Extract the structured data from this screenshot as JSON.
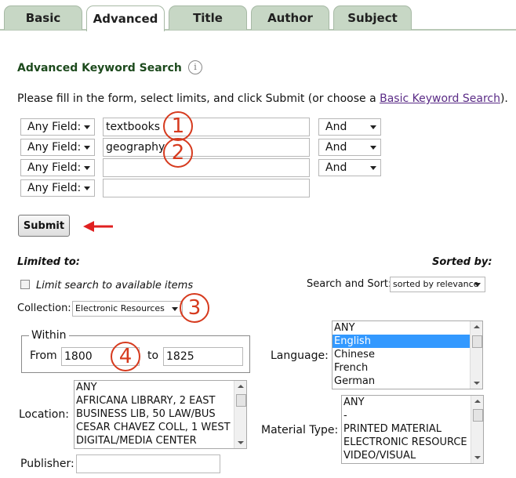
{
  "tabs": [
    {
      "label": "Basic",
      "active": false
    },
    {
      "label": "Advanced",
      "active": true
    },
    {
      "label": "Title",
      "active": false
    },
    {
      "label": "Author",
      "active": false
    },
    {
      "label": "Subject",
      "active": false
    }
  ],
  "heading": "Advanced Keyword Search",
  "info_icon": "info-icon",
  "instructions": {
    "before": "Please fill in the form, select limits, and click Submit (or choose a ",
    "link": "Basic Keyword Search",
    "after": ")."
  },
  "rows": [
    {
      "field": "Any Field:",
      "value": "textbooks",
      "operator": "And"
    },
    {
      "field": "Any Field:",
      "value": "geography",
      "operator": "And"
    },
    {
      "field": "Any Field:",
      "value": "",
      "operator": "And"
    },
    {
      "field": "Any Field:",
      "value": ""
    }
  ],
  "annotations": [
    "1",
    "2",
    "3",
    "4"
  ],
  "annotation_color": "#d63a1e",
  "submit_label": "Submit",
  "limits": {
    "limited_to": "Limited to:",
    "sorted_by": "Sorted by:",
    "available_label": "Limit search to available items",
    "search_sort_label": "Search and Sort:",
    "search_sort_value": "sorted by relevance",
    "collection_label": "Collection:",
    "collection_value": "Electronic Resources",
    "within_legend": "Within",
    "from_label": "From",
    "from_value": "1800",
    "to_label": "to",
    "to_value": "1825",
    "language_label": "Language:",
    "language_options": [
      "ANY",
      "English",
      "Chinese",
      "French",
      "German"
    ],
    "language_selected": "English",
    "location_label": "Location:",
    "location_options": [
      "ANY",
      "AFRICANA LIBRARY, 2 EAST",
      "BUSINESS LIB, 50 LAW/BUS",
      "CESAR CHAVEZ COLL, 1 WEST",
      "DIGITAL/MEDIA CENTER"
    ],
    "material_label": "Material Type:",
    "material_options": [
      "ANY",
      "-",
      "PRINTED MATERIAL",
      "ELECTRONIC RESOURCE",
      "VIDEO/VISUAL"
    ],
    "publisher_label": "Publisher:",
    "publisher_value": ""
  },
  "colors": {
    "tab_bg": "#c7d7c5",
    "heading": "#1d4a1d",
    "link": "#5a2b86",
    "selected": "#3399ff"
  }
}
